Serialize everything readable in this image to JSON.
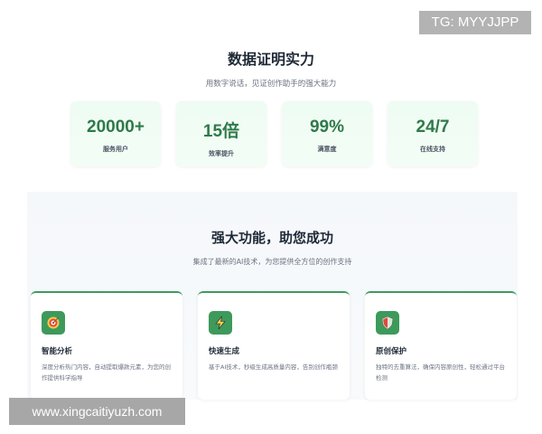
{
  "watermarks": {
    "top_right": "TG: MYYJJPP",
    "bottom_left": "www.xingcaitiyuzh.com"
  },
  "stats_section": {
    "title": "数据证明实力",
    "subtitle": "用数字说话，见证创作助手的强大能力",
    "stats": [
      {
        "value": "20000+",
        "label": "服务用户"
      },
      {
        "value": "15倍",
        "label": "效率提升"
      },
      {
        "value": "99%",
        "label": "满意度"
      },
      {
        "value": "24/7",
        "label": "在线支持"
      }
    ]
  },
  "features_section": {
    "title": "强大功能，助您成功",
    "subtitle": "集成了最新的AI技术，为您提供全方位的创作支持",
    "features": [
      {
        "name": "智能分析",
        "description": "深度分析热门内容，自动提取爆款元素，为您的创作提供科学指导",
        "icon": "target-icon"
      },
      {
        "name": "快速生成",
        "description": "基于AI技术，秒级生成高质量内容，告别创作瓶颈",
        "icon": "lightning-icon"
      },
      {
        "name": "原创保护",
        "description": "独特的去重算法，确保内容原创性，轻松通过平台检测",
        "icon": "shield-icon"
      }
    ]
  },
  "colors": {
    "accent": "#3d9a5b",
    "stat_value": "#2f7a4a",
    "stat_card_bg": "#eefcf3"
  }
}
